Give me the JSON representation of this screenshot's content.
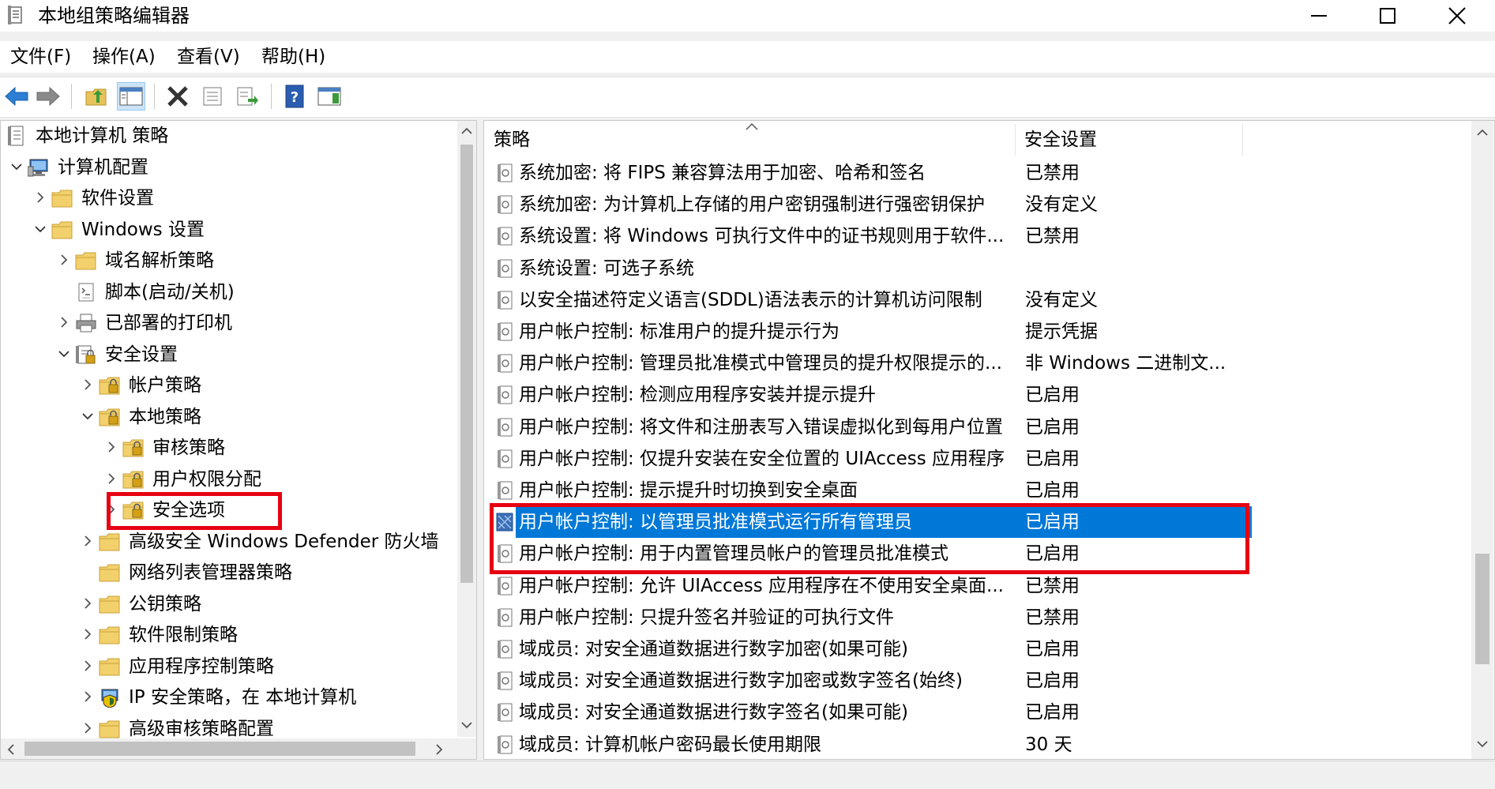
{
  "window": {
    "title": "本地组策略编辑器"
  },
  "menu": [
    {
      "label": "文件(F)"
    },
    {
      "label": "操作(A)"
    },
    {
      "label": "查看(V)"
    },
    {
      "label": "帮助(H)"
    }
  ],
  "toolbar": {
    "buttons": [
      "back-icon",
      "forward-icon",
      "up-folder-icon",
      "show-hide-tree-icon",
      "delete-icon",
      "properties-icon",
      "export-list-icon",
      "help-icon",
      "view-icon"
    ]
  },
  "tree": [
    {
      "label": "本地计算机 策略",
      "icon": "policy-icon",
      "chevron": "none"
    },
    {
      "label": "计算机配置",
      "icon": "computer-icon",
      "chevron": "down"
    },
    {
      "label": "软件设置",
      "icon": "folder-icon",
      "chevron": "right"
    },
    {
      "label": "Windows 设置",
      "icon": "folder-icon",
      "chevron": "down"
    },
    {
      "label": "域名解析策略",
      "icon": "folder-icon",
      "chevron": "right"
    },
    {
      "label": "脚本(启动/关机)",
      "icon": "script-icon",
      "chevron": "none"
    },
    {
      "label": "已部署的打印机",
      "icon": "printer-icon",
      "chevron": "right"
    },
    {
      "label": "安全设置",
      "icon": "security-icon",
      "chevron": "down"
    },
    {
      "label": "帐户策略",
      "icon": "secure-folder-icon",
      "chevron": "right"
    },
    {
      "label": "本地策略",
      "icon": "secure-folder-icon",
      "chevron": "down"
    },
    {
      "label": "审核策略",
      "icon": "secure-folder-icon",
      "chevron": "right"
    },
    {
      "label": "用户权限分配",
      "icon": "secure-folder-icon",
      "chevron": "right"
    },
    {
      "label": "安全选项",
      "icon": "secure-folder-icon",
      "chevron": "right"
    },
    {
      "label": "高级安全 Windows Defender 防火墙",
      "icon": "folder-icon",
      "chevron": "right"
    },
    {
      "label": "网络列表管理器策略",
      "icon": "folder-icon",
      "chevron": "none"
    },
    {
      "label": "公钥策略",
      "icon": "folder-icon",
      "chevron": "right"
    },
    {
      "label": "软件限制策略",
      "icon": "folder-icon",
      "chevron": "right"
    },
    {
      "label": "应用程序控制策略",
      "icon": "folder-icon",
      "chevron": "right"
    },
    {
      "label": "IP 安全策略，在 本地计算机",
      "icon": "ipsec-icon",
      "chevron": "right"
    },
    {
      "label": "高级审核策略配置",
      "icon": "folder-icon",
      "chevron": "right"
    }
  ],
  "list": {
    "col_policy": "策略",
    "col_setting": "安全设置",
    "rows": [
      {
        "name": "系统加密: 将 FIPS 兼容算法用于加密、哈希和签名",
        "value": "已禁用"
      },
      {
        "name": "系统加密: 为计算机上存储的用户密钥强制进行强密钥保护",
        "value": "没有定义"
      },
      {
        "name": "系统设置: 将 Windows 可执行文件中的证书规则用于软件...",
        "value": "已禁用"
      },
      {
        "name": "系统设置: 可选子系统",
        "value": ""
      },
      {
        "name": "以安全描述符定义语言(SDDL)语法表示的计算机访问限制",
        "value": "没有定义"
      },
      {
        "name": "用户帐户控制: 标准用户的提升提示行为",
        "value": "提示凭据"
      },
      {
        "name": "用户帐户控制: 管理员批准模式中管理员的提升权限提示的...",
        "value": "非 Windows 二进制文..."
      },
      {
        "name": "用户帐户控制: 检测应用程序安装并提示提升",
        "value": "已启用"
      },
      {
        "name": "用户帐户控制: 将文件和注册表写入错误虚拟化到每用户位置",
        "value": "已启用"
      },
      {
        "name": "用户帐户控制: 仅提升安装在安全位置的 UIAccess 应用程序",
        "value": "已启用"
      },
      {
        "name": "用户帐户控制: 提示提升时切换到安全桌面",
        "value": "已启用"
      },
      {
        "name": "用户帐户控制: 以管理员批准模式运行所有管理员",
        "value": "已启用"
      },
      {
        "name": "用户帐户控制: 用于内置管理员帐户的管理员批准模式",
        "value": "已启用"
      },
      {
        "name": "用户帐户控制: 允许 UIAccess 应用程序在不使用安全桌面...",
        "value": "已禁用"
      },
      {
        "name": "用户帐户控制: 只提升签名并验证的可执行文件",
        "value": "已禁用"
      },
      {
        "name": "域成员: 对安全通道数据进行数字加密(如果可能)",
        "value": "已启用"
      },
      {
        "name": "域成员: 对安全通道数据进行数字加密或数字签名(始终)",
        "value": "已启用"
      },
      {
        "name": "域成员: 对安全通道数据进行数字签名(如果可能)",
        "value": "已启用"
      },
      {
        "name": "域成员: 计算机帐户密码最长使用期限",
        "value": "30 天"
      }
    ]
  }
}
